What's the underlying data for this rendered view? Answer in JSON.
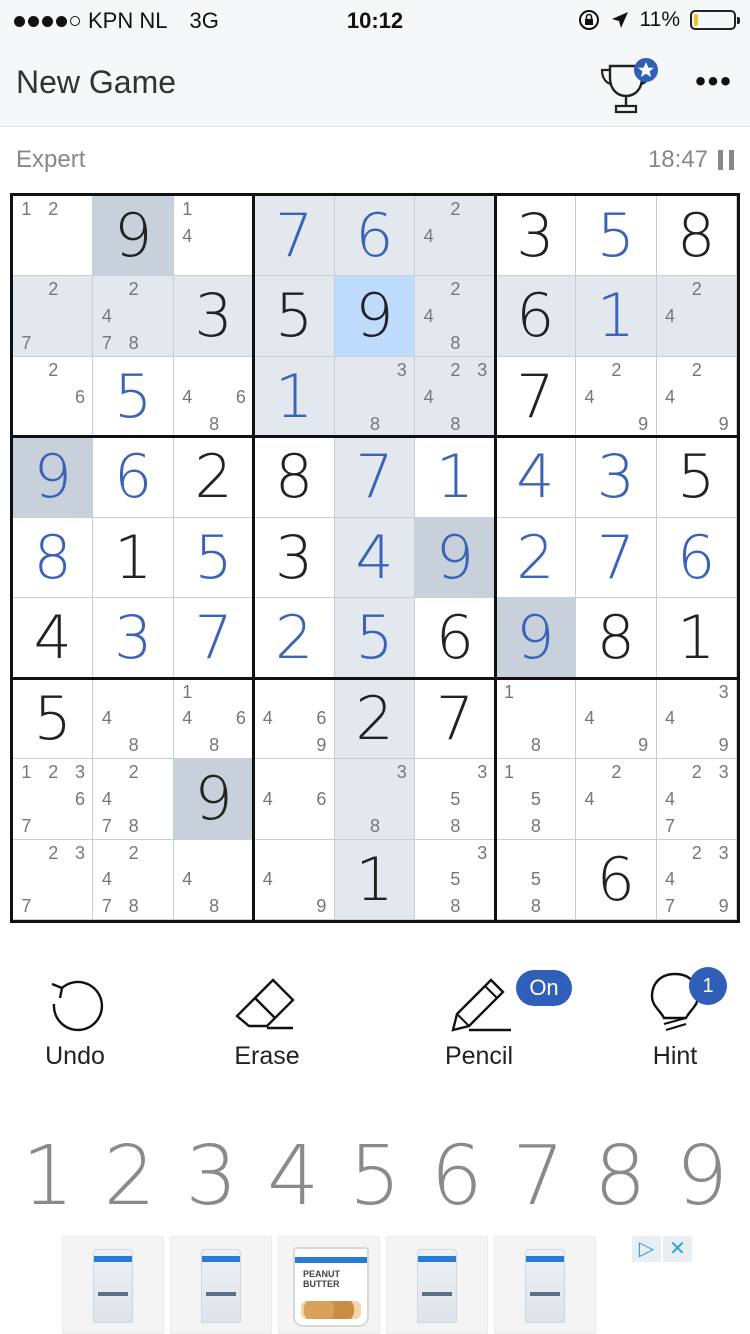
{
  "status_bar": {
    "carrier": "KPN NL",
    "network": "3G",
    "time": "10:12",
    "battery_percent": "11%",
    "battery_level": 0.11,
    "signal_dots": 4
  },
  "nav": {
    "title": "New Game",
    "trophy_icon": "trophy-star-icon",
    "more_icon": "more-icon"
  },
  "game": {
    "difficulty": "Expert",
    "timer": "18:47"
  },
  "board": {
    "rows": [
      [
        {
          "v": "",
          "notes": [
            1,
            2
          ]
        },
        {
          "v": "9",
          "t": "g",
          "bg": "same"
        },
        {
          "v": "",
          "notes": [
            1,
            4
          ]
        },
        {
          "v": "7",
          "t": "u",
          "bg": "hl"
        },
        {
          "v": "6",
          "t": "u",
          "bg": "hl"
        },
        {
          "v": "",
          "notes": [
            2,
            4
          ],
          "bg": "hl"
        },
        {
          "v": "3",
          "t": "g"
        },
        {
          "v": "5",
          "t": "u"
        },
        {
          "v": "8",
          "t": "g"
        }
      ],
      [
        {
          "v": "",
          "notes": [
            2,
            7
          ],
          "bg": "hl"
        },
        {
          "v": "",
          "notes": [
            2,
            4,
            7,
            8
          ],
          "bg": "hl"
        },
        {
          "v": "3",
          "t": "g",
          "bg": "hl"
        },
        {
          "v": "5",
          "t": "g",
          "bg": "hl"
        },
        {
          "v": "9",
          "t": "g",
          "bg": "sel"
        },
        {
          "v": "",
          "notes": [
            2,
            4,
            8
          ],
          "bg": "hl"
        },
        {
          "v": "6",
          "t": "g",
          "bg": "hl"
        },
        {
          "v": "1",
          "t": "u",
          "bg": "hl"
        },
        {
          "v": "",
          "notes": [
            2,
            4
          ],
          "bg": "hl"
        }
      ],
      [
        {
          "v": "",
          "notes": [
            2,
            6
          ]
        },
        {
          "v": "5",
          "t": "u"
        },
        {
          "v": "",
          "notes": [
            4,
            6,
            8
          ]
        },
        {
          "v": "1",
          "t": "u",
          "bg": "hl"
        },
        {
          "v": "",
          "notes": [
            3,
            8
          ],
          "bg": "hl"
        },
        {
          "v": "",
          "notes": [
            2,
            3,
            4,
            8
          ],
          "bg": "hl"
        },
        {
          "v": "7",
          "t": "g"
        },
        {
          "v": "",
          "notes": [
            2,
            4,
            9
          ]
        },
        {
          "v": "",
          "notes": [
            2,
            4,
            9
          ]
        }
      ],
      [
        {
          "v": "9",
          "t": "u",
          "bg": "same"
        },
        {
          "v": "6",
          "t": "u"
        },
        {
          "v": "2",
          "t": "g"
        },
        {
          "v": "8",
          "t": "g"
        },
        {
          "v": "7",
          "t": "u",
          "bg": "hl"
        },
        {
          "v": "1",
          "t": "u"
        },
        {
          "v": "4",
          "t": "u"
        },
        {
          "v": "3",
          "t": "u"
        },
        {
          "v": "5",
          "t": "g"
        }
      ],
      [
        {
          "v": "8",
          "t": "u"
        },
        {
          "v": "1",
          "t": "g"
        },
        {
          "v": "5",
          "t": "u"
        },
        {
          "v": "3",
          "t": "g"
        },
        {
          "v": "4",
          "t": "u",
          "bg": "hl"
        },
        {
          "v": "9",
          "t": "u",
          "bg": "same"
        },
        {
          "v": "2",
          "t": "u"
        },
        {
          "v": "7",
          "t": "u"
        },
        {
          "v": "6",
          "t": "u"
        }
      ],
      [
        {
          "v": "4",
          "t": "g"
        },
        {
          "v": "3",
          "t": "u"
        },
        {
          "v": "7",
          "t": "u"
        },
        {
          "v": "2",
          "t": "u"
        },
        {
          "v": "5",
          "t": "u",
          "bg": "hl"
        },
        {
          "v": "6",
          "t": "g"
        },
        {
          "v": "9",
          "t": "u",
          "bg": "same"
        },
        {
          "v": "8",
          "t": "g"
        },
        {
          "v": "1",
          "t": "g"
        }
      ],
      [
        {
          "v": "5",
          "t": "g"
        },
        {
          "v": "",
          "notes": [
            4,
            8
          ]
        },
        {
          "v": "",
          "notes": [
            1,
            4,
            6,
            8
          ]
        },
        {
          "v": "",
          "notes": [
            4,
            6,
            9
          ]
        },
        {
          "v": "2",
          "t": "g",
          "bg": "hl"
        },
        {
          "v": "7",
          "t": "g"
        },
        {
          "v": "",
          "notes": [
            1,
            8
          ]
        },
        {
          "v": "",
          "notes": [
            4,
            9
          ]
        },
        {
          "v": "",
          "notes": [
            3,
            4,
            9
          ]
        }
      ],
      [
        {
          "v": "",
          "notes": [
            1,
            2,
            3,
            6,
            7
          ]
        },
        {
          "v": "",
          "notes": [
            2,
            4,
            7,
            8
          ]
        },
        {
          "v": "9",
          "t": "g",
          "bg": "same"
        },
        {
          "v": "",
          "notes": [
            4,
            6
          ]
        },
        {
          "v": "",
          "notes": [
            3,
            8
          ],
          "bg": "hl"
        },
        {
          "v": "",
          "notes": [
            3,
            5,
            8
          ]
        },
        {
          "v": "",
          "notes": [
            1,
            5,
            8
          ]
        },
        {
          "v": "",
          "notes": [
            2,
            4
          ]
        },
        {
          "v": "",
          "notes": [
            2,
            3,
            4,
            7
          ]
        }
      ],
      [
        {
          "v": "",
          "notes": [
            2,
            3,
            7
          ]
        },
        {
          "v": "",
          "notes": [
            2,
            4,
            7,
            8
          ]
        },
        {
          "v": "",
          "notes": [
            4,
            8
          ]
        },
        {
          "v": "",
          "notes": [
            4,
            9
          ]
        },
        {
          "v": "1",
          "t": "g",
          "bg": "hl"
        },
        {
          "v": "",
          "notes": [
            3,
            5,
            8
          ]
        },
        {
          "v": "",
          "notes": [
            5,
            8
          ]
        },
        {
          "v": "6",
          "t": "g"
        },
        {
          "v": "",
          "notes": [
            2,
            3,
            4,
            7,
            9
          ]
        }
      ]
    ]
  },
  "tools": {
    "undo": "Undo",
    "erase": "Erase",
    "pencil": "Pencil",
    "pencil_state": "On",
    "hint": "Hint",
    "hint_count": "1"
  },
  "numpad": [
    "1",
    "2",
    "3",
    "4",
    "5",
    "6",
    "7",
    "8",
    "9"
  ],
  "ad": {
    "products": [
      {
        "icon": "bcaa-pouch-icon"
      },
      {
        "icon": "creatine-pouch-icon"
      },
      {
        "icon": "peanut-butter-tub-icon",
        "text": "PEANUT BUTTER"
      },
      {
        "icon": "weight-gainer-pouch-icon"
      },
      {
        "icon": "glutamine-pouch-icon"
      }
    ],
    "choices_icons": [
      "adchoices-icon",
      "close-icon"
    ]
  },
  "colors": {
    "user_digit": "#3a63b8",
    "given_digit": "#222222",
    "highlight": "#e3e8ee",
    "same_number": "#c7d0db",
    "selected": "#bfdcff",
    "accent": "#2f5fb8"
  }
}
